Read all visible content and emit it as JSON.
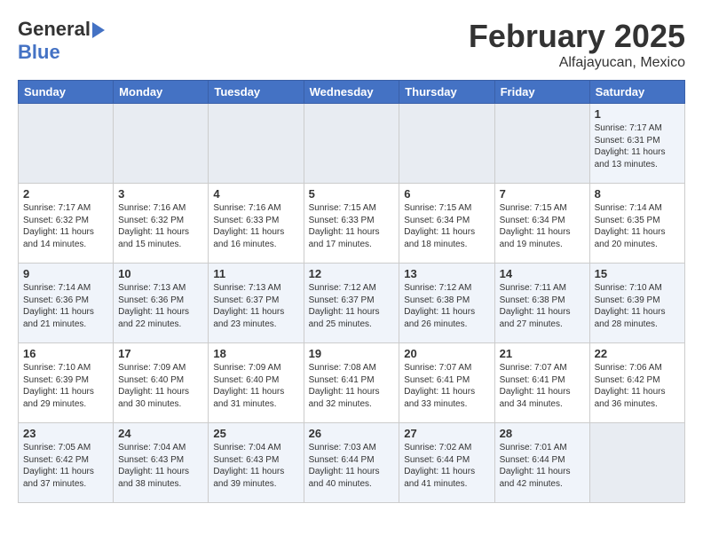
{
  "logo": {
    "general": "General",
    "blue": "Blue"
  },
  "title": "February 2025",
  "location": "Alfajayucan, Mexico",
  "weekdays": [
    "Sunday",
    "Monday",
    "Tuesday",
    "Wednesday",
    "Thursday",
    "Friday",
    "Saturday"
  ],
  "weeks": [
    [
      {
        "day": "",
        "info": ""
      },
      {
        "day": "",
        "info": ""
      },
      {
        "day": "",
        "info": ""
      },
      {
        "day": "",
        "info": ""
      },
      {
        "day": "",
        "info": ""
      },
      {
        "day": "",
        "info": ""
      },
      {
        "day": "1",
        "info": "Sunrise: 7:17 AM\nSunset: 6:31 PM\nDaylight: 11 hours and 13 minutes."
      }
    ],
    [
      {
        "day": "2",
        "info": "Sunrise: 7:17 AM\nSunset: 6:32 PM\nDaylight: 11 hours and 14 minutes."
      },
      {
        "day": "3",
        "info": "Sunrise: 7:16 AM\nSunset: 6:32 PM\nDaylight: 11 hours and 15 minutes."
      },
      {
        "day": "4",
        "info": "Sunrise: 7:16 AM\nSunset: 6:33 PM\nDaylight: 11 hours and 16 minutes."
      },
      {
        "day": "5",
        "info": "Sunrise: 7:15 AM\nSunset: 6:33 PM\nDaylight: 11 hours and 17 minutes."
      },
      {
        "day": "6",
        "info": "Sunrise: 7:15 AM\nSunset: 6:34 PM\nDaylight: 11 hours and 18 minutes."
      },
      {
        "day": "7",
        "info": "Sunrise: 7:15 AM\nSunset: 6:34 PM\nDaylight: 11 hours and 19 minutes."
      },
      {
        "day": "8",
        "info": "Sunrise: 7:14 AM\nSunset: 6:35 PM\nDaylight: 11 hours and 20 minutes."
      }
    ],
    [
      {
        "day": "9",
        "info": "Sunrise: 7:14 AM\nSunset: 6:36 PM\nDaylight: 11 hours and 21 minutes."
      },
      {
        "day": "10",
        "info": "Sunrise: 7:13 AM\nSunset: 6:36 PM\nDaylight: 11 hours and 22 minutes."
      },
      {
        "day": "11",
        "info": "Sunrise: 7:13 AM\nSunset: 6:37 PM\nDaylight: 11 hours and 23 minutes."
      },
      {
        "day": "12",
        "info": "Sunrise: 7:12 AM\nSunset: 6:37 PM\nDaylight: 11 hours and 25 minutes."
      },
      {
        "day": "13",
        "info": "Sunrise: 7:12 AM\nSunset: 6:38 PM\nDaylight: 11 hours and 26 minutes."
      },
      {
        "day": "14",
        "info": "Sunrise: 7:11 AM\nSunset: 6:38 PM\nDaylight: 11 hours and 27 minutes."
      },
      {
        "day": "15",
        "info": "Sunrise: 7:10 AM\nSunset: 6:39 PM\nDaylight: 11 hours and 28 minutes."
      }
    ],
    [
      {
        "day": "16",
        "info": "Sunrise: 7:10 AM\nSunset: 6:39 PM\nDaylight: 11 hours and 29 minutes."
      },
      {
        "day": "17",
        "info": "Sunrise: 7:09 AM\nSunset: 6:40 PM\nDaylight: 11 hours and 30 minutes."
      },
      {
        "day": "18",
        "info": "Sunrise: 7:09 AM\nSunset: 6:40 PM\nDaylight: 11 hours and 31 minutes."
      },
      {
        "day": "19",
        "info": "Sunrise: 7:08 AM\nSunset: 6:41 PM\nDaylight: 11 hours and 32 minutes."
      },
      {
        "day": "20",
        "info": "Sunrise: 7:07 AM\nSunset: 6:41 PM\nDaylight: 11 hours and 33 minutes."
      },
      {
        "day": "21",
        "info": "Sunrise: 7:07 AM\nSunset: 6:41 PM\nDaylight: 11 hours and 34 minutes."
      },
      {
        "day": "22",
        "info": "Sunrise: 7:06 AM\nSunset: 6:42 PM\nDaylight: 11 hours and 36 minutes."
      }
    ],
    [
      {
        "day": "23",
        "info": "Sunrise: 7:05 AM\nSunset: 6:42 PM\nDaylight: 11 hours and 37 minutes."
      },
      {
        "day": "24",
        "info": "Sunrise: 7:04 AM\nSunset: 6:43 PM\nDaylight: 11 hours and 38 minutes."
      },
      {
        "day": "25",
        "info": "Sunrise: 7:04 AM\nSunset: 6:43 PM\nDaylight: 11 hours and 39 minutes."
      },
      {
        "day": "26",
        "info": "Sunrise: 7:03 AM\nSunset: 6:44 PM\nDaylight: 11 hours and 40 minutes."
      },
      {
        "day": "27",
        "info": "Sunrise: 7:02 AM\nSunset: 6:44 PM\nDaylight: 11 hours and 41 minutes."
      },
      {
        "day": "28",
        "info": "Sunrise: 7:01 AM\nSunset: 6:44 PM\nDaylight: 11 hours and 42 minutes."
      },
      {
        "day": "",
        "info": ""
      }
    ]
  ]
}
